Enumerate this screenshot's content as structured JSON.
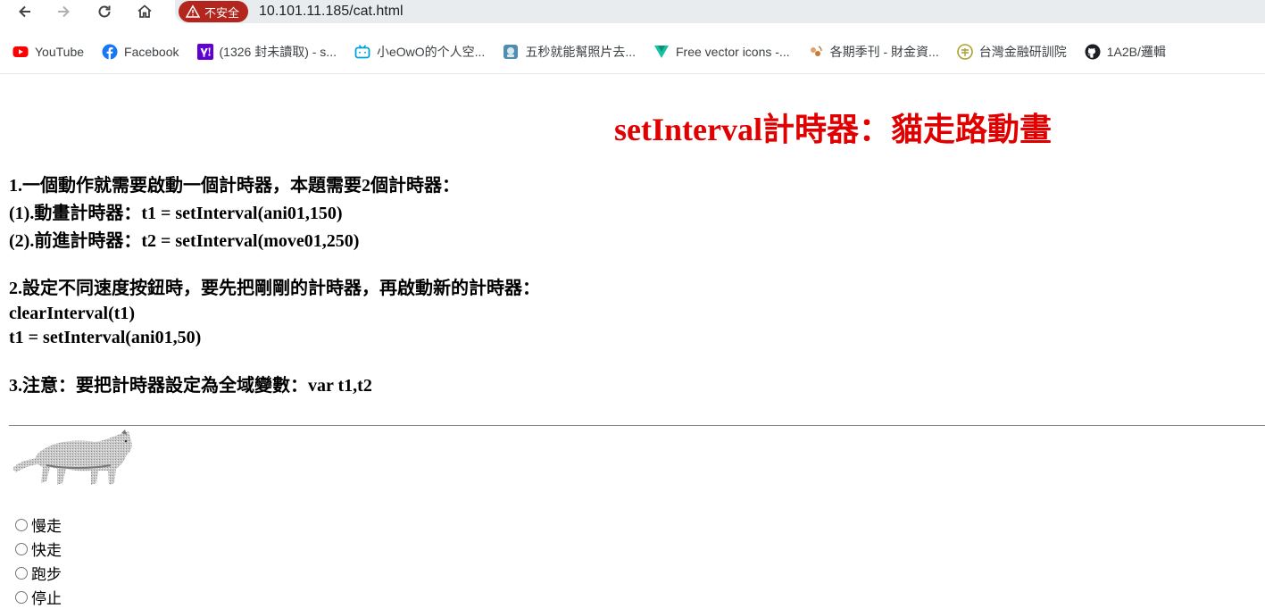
{
  "browser": {
    "security_label": "不安全",
    "url": "10.101.11.185/cat.html",
    "bookmarks": [
      {
        "label": "YouTube",
        "icon": "youtube-icon"
      },
      {
        "label": "Facebook",
        "icon": "facebook-icon"
      },
      {
        "label": "(1326 封未讀取) - s...",
        "icon": "yahoo-icon"
      },
      {
        "label": "小eOwO的个人空...",
        "icon": "bilibili-icon"
      },
      {
        "label": "五秒就能幫照片去...",
        "icon": "app-icon"
      },
      {
        "label": "Free vector icons -...",
        "icon": "vector-icon"
      },
      {
        "label": "各期季刊 - 財金資...",
        "icon": "finance-icon"
      },
      {
        "label": "台灣金融研訓院",
        "icon": "institute-icon"
      },
      {
        "label": "1A2B/邏輯",
        "icon": "github-icon"
      }
    ],
    "colors": {
      "security": "#b3261e",
      "omnibox": "#e9ecef"
    }
  },
  "page": {
    "title": "setInterval計時器：貓走路動畫",
    "title_color": "#e00000",
    "lines": {
      "l1": "1.一個動作就需要啟動一個計時器，本題需要2個計時器：",
      "l2": "(1).動畫計時器：t1 = setInterval(ani01,150)",
      "l3": "(2).前進計時器：t2 = setInterval(move01,250)",
      "l4": "2.設定不同速度按鈕時，要先把剛剛的計時器，再啟動新的計時器：",
      "l5": "clearInterval(t1)",
      "l6": "t1 = setInterval(ani01,50)",
      "l7": "3.注意：要把計時器設定為全域變數：var t1,t2"
    },
    "speed_options": [
      "慢走",
      "快走",
      "跑步",
      "停止"
    ]
  }
}
